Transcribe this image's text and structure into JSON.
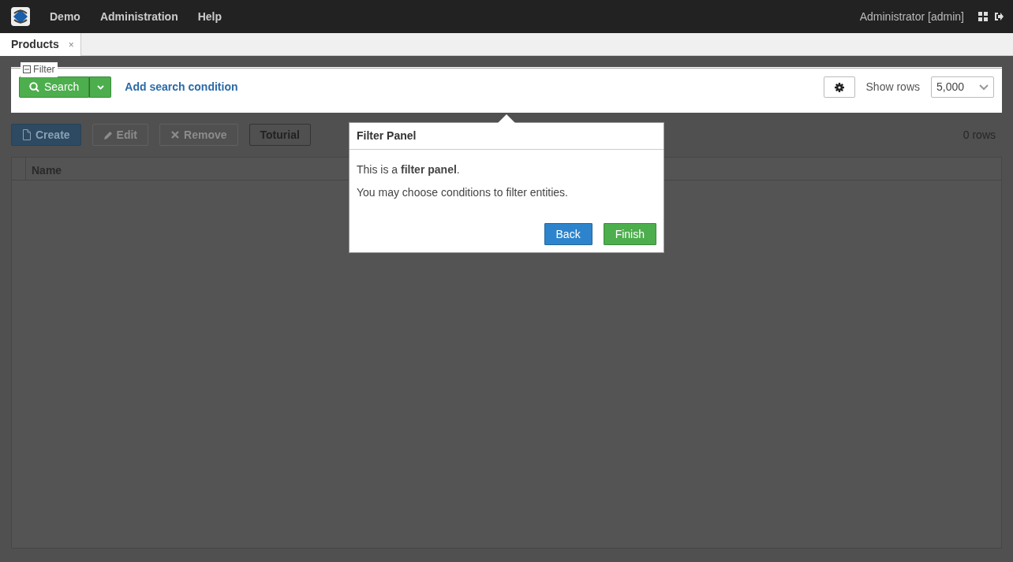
{
  "navbar": {
    "menu": [
      {
        "label": "Demo"
      },
      {
        "label": "Administration"
      },
      {
        "label": "Help"
      }
    ],
    "user": "Administrator [admin]"
  },
  "tabs": [
    {
      "label": "Products",
      "selected": true,
      "close": "×"
    }
  ],
  "filter": {
    "legend": "Filter",
    "expanded": true,
    "search_button": "Search",
    "add_condition": "Add search condition",
    "show_rows_label": "Show rows",
    "show_rows_value": "5,000"
  },
  "toolbar": {
    "buttons": [
      {
        "label": "Create",
        "kind": "create",
        "disabled": false
      },
      {
        "label": "Edit",
        "kind": "edit",
        "disabled": true
      },
      {
        "label": "Remove",
        "kind": "remove",
        "disabled": true
      },
      {
        "label": "Toturial",
        "kind": "plain",
        "disabled": false
      }
    ],
    "row_count": "0 rows"
  },
  "table": {
    "columns": [
      "Name"
    ]
  },
  "popover": {
    "title": "Filter Panel",
    "lines": [
      "This is a **filter panel**.",
      "You may choose conditions to filter entities."
    ],
    "buttons": [
      {
        "label": "Back",
        "kind": "primary"
      },
      {
        "label": "Finish",
        "kind": "success"
      }
    ]
  }
}
